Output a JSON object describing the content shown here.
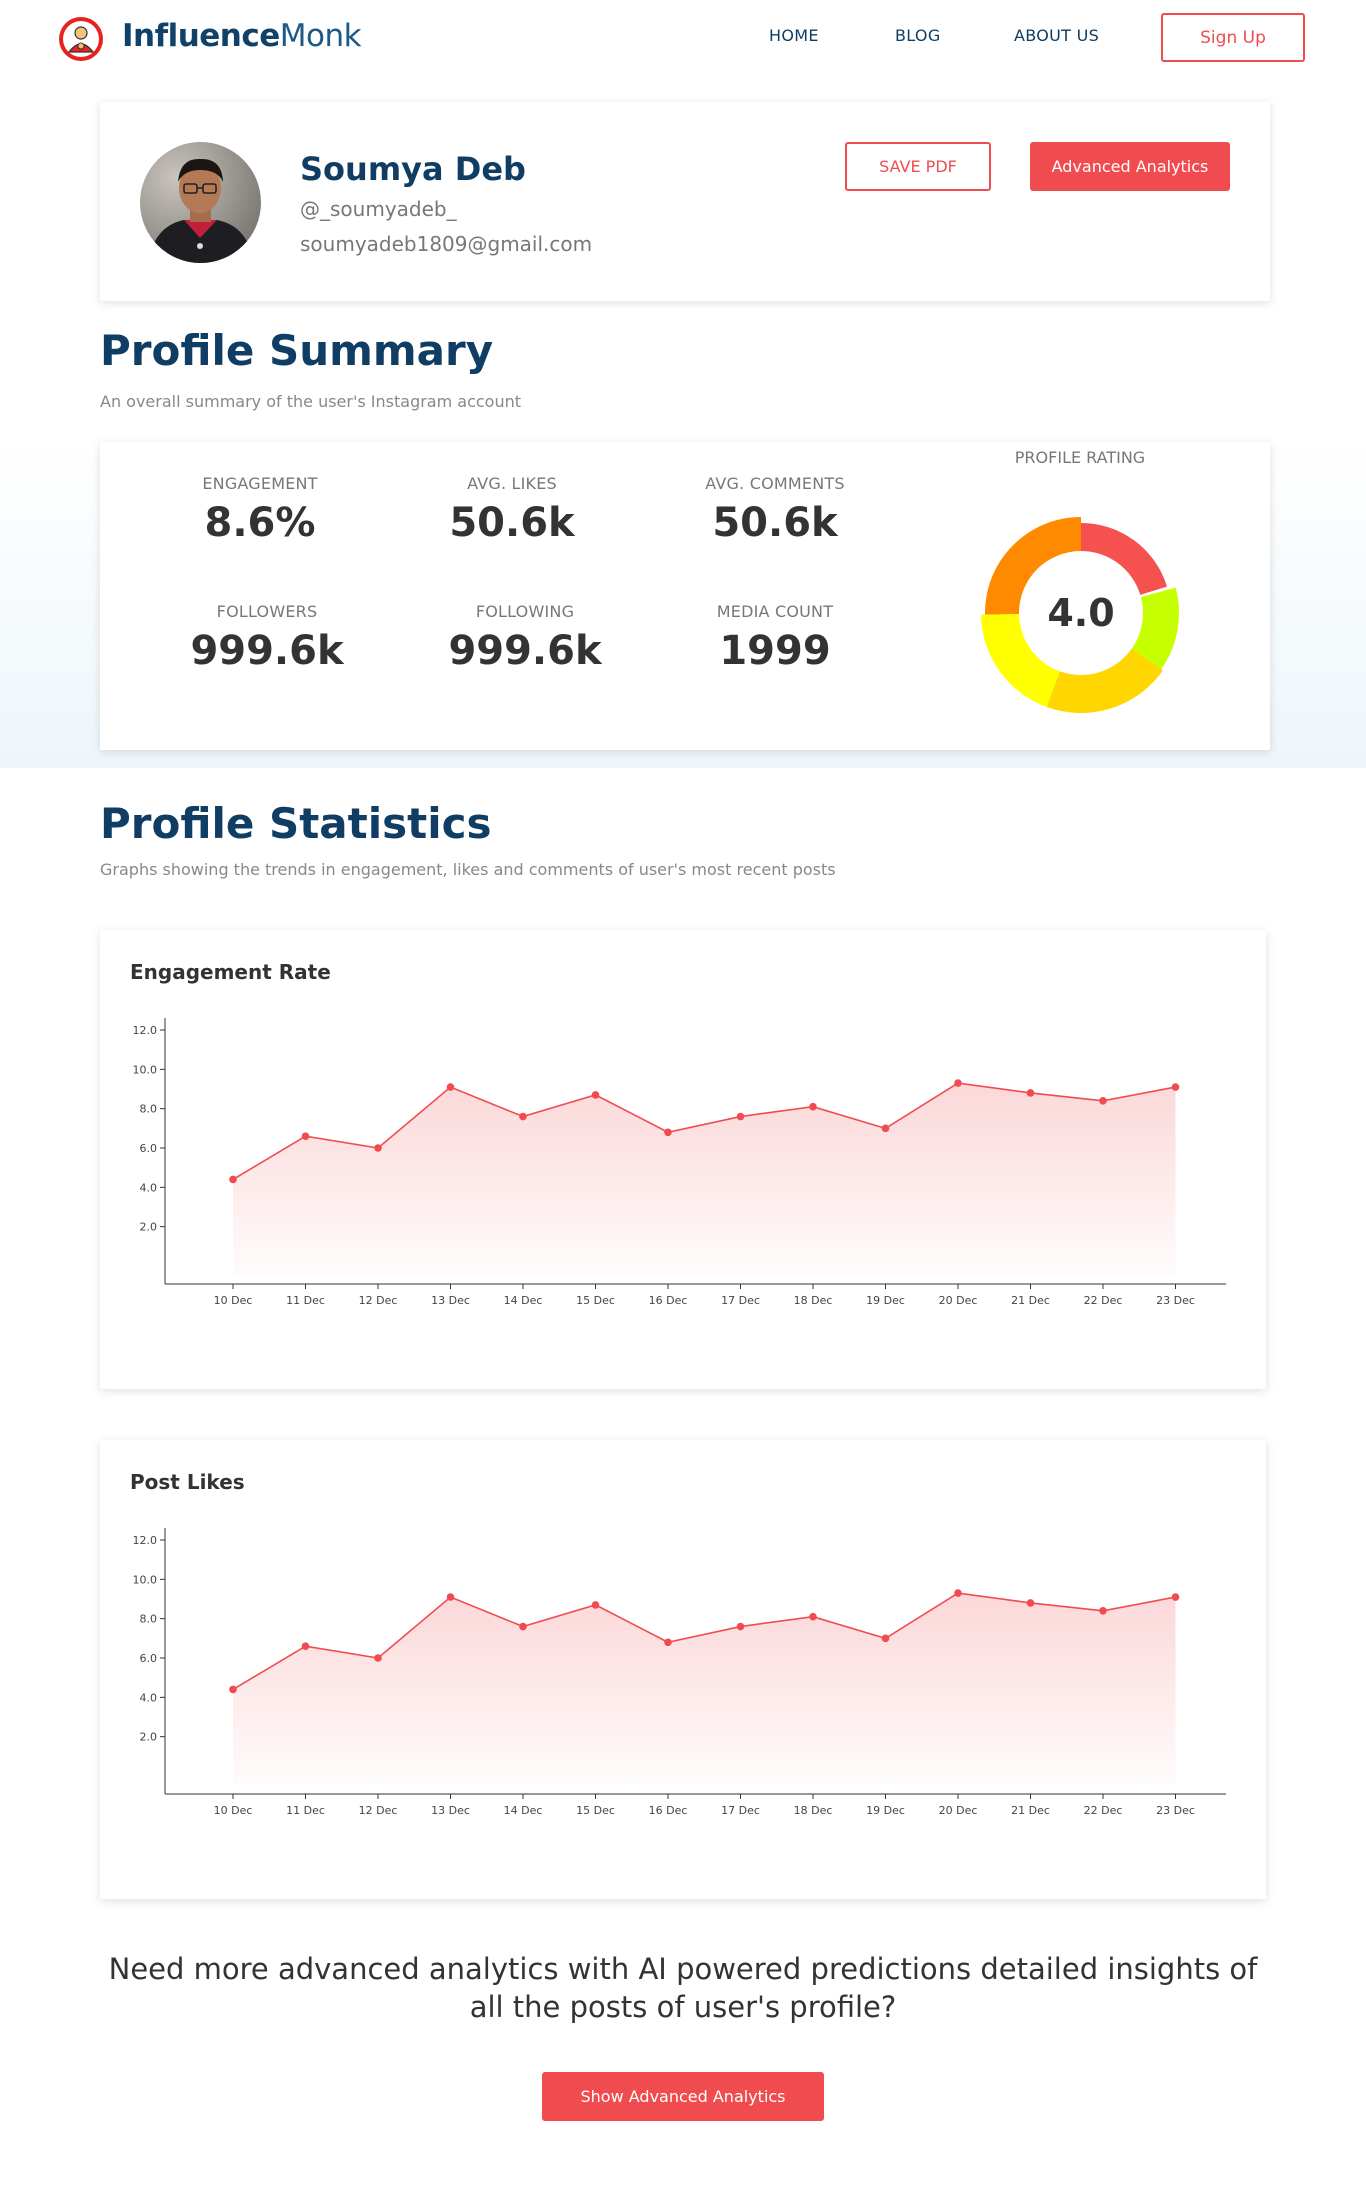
{
  "header": {
    "brand_bold": "Influence",
    "brand_light": "Monk",
    "nav": [
      "HOME",
      "BLOG",
      "ABOUT US"
    ],
    "signup_label": "Sign Up"
  },
  "profile": {
    "name": "Soumya Deb",
    "handle": "@_soumyadeb_",
    "email": "soumyadeb1809@gmail.com",
    "save_pdf_label": "SAVE PDF",
    "advanced_label": "Advanced Analytics"
  },
  "summary": {
    "title": "Profile Summary",
    "subtitle": "An overall summary of the user's Instagram account",
    "stats": [
      {
        "label": "ENGAGEMENT",
        "value": "8.6%"
      },
      {
        "label": "AVG. LIKES",
        "value": "50.6k"
      },
      {
        "label": "AVG. COMMENTS",
        "value": "50.6k"
      },
      {
        "label": "FOLLOWERS",
        "value": "999.6k"
      },
      {
        "label": "FOLLOWING",
        "value": "999.6k"
      },
      {
        "label": "MEDIA COUNT",
        "value": "1999"
      }
    ],
    "rating_label": "PROFILE RATING",
    "rating_value": "4.0",
    "rating_colors": [
      "#f5524f",
      "#ff8a00",
      "#ffd600",
      "#ffff00",
      "#c6ff00"
    ]
  },
  "statistics": {
    "title": "Profile Statistics",
    "subtitle": "Graphs showing the trends in engagement, likes and comments of user's most recent posts"
  },
  "chart_data": [
    {
      "type": "area",
      "title": "Engagement Rate",
      "categories": [
        "10 Dec",
        "11 Dec",
        "12 Dec",
        "13 Dec",
        "14 Dec",
        "15 Dec",
        "16 Dec",
        "17 Dec",
        "18 Dec",
        "19 Dec",
        "20 Dec",
        "21 Dec",
        "22 Dec",
        "23 Dec"
      ],
      "values": [
        4.4,
        6.6,
        6.0,
        9.1,
        7.6,
        8.7,
        6.8,
        7.6,
        8.1,
        7.0,
        9.3,
        8.8,
        8.4,
        9.1
      ],
      "yticks": [
        "2.0",
        "4.0",
        "6.0",
        "8.0",
        "10.0",
        "12.0"
      ],
      "ylim": [
        0,
        12
      ],
      "color": "#f04c50"
    },
    {
      "type": "area",
      "title": "Post Likes",
      "categories": [
        "10 Dec",
        "11 Dec",
        "12 Dec",
        "13 Dec",
        "14 Dec",
        "15 Dec",
        "16 Dec",
        "17 Dec",
        "18 Dec",
        "19 Dec",
        "20 Dec",
        "21 Dec",
        "22 Dec",
        "23 Dec"
      ],
      "values": [
        4.4,
        6.6,
        6.0,
        9.1,
        7.6,
        8.7,
        6.8,
        7.6,
        8.1,
        7.0,
        9.3,
        8.8,
        8.4,
        9.1
      ],
      "yticks": [
        "2.0",
        "4.0",
        "6.0",
        "8.0",
        "10.0",
        "12.0"
      ],
      "ylim": [
        0,
        12
      ],
      "color": "#f04c50"
    }
  ],
  "cta": {
    "text": "Need more advanced analytics with AI powered predictions detailed insights of all the posts of user's profile?",
    "button_label": "Show Advanced Analytics"
  }
}
